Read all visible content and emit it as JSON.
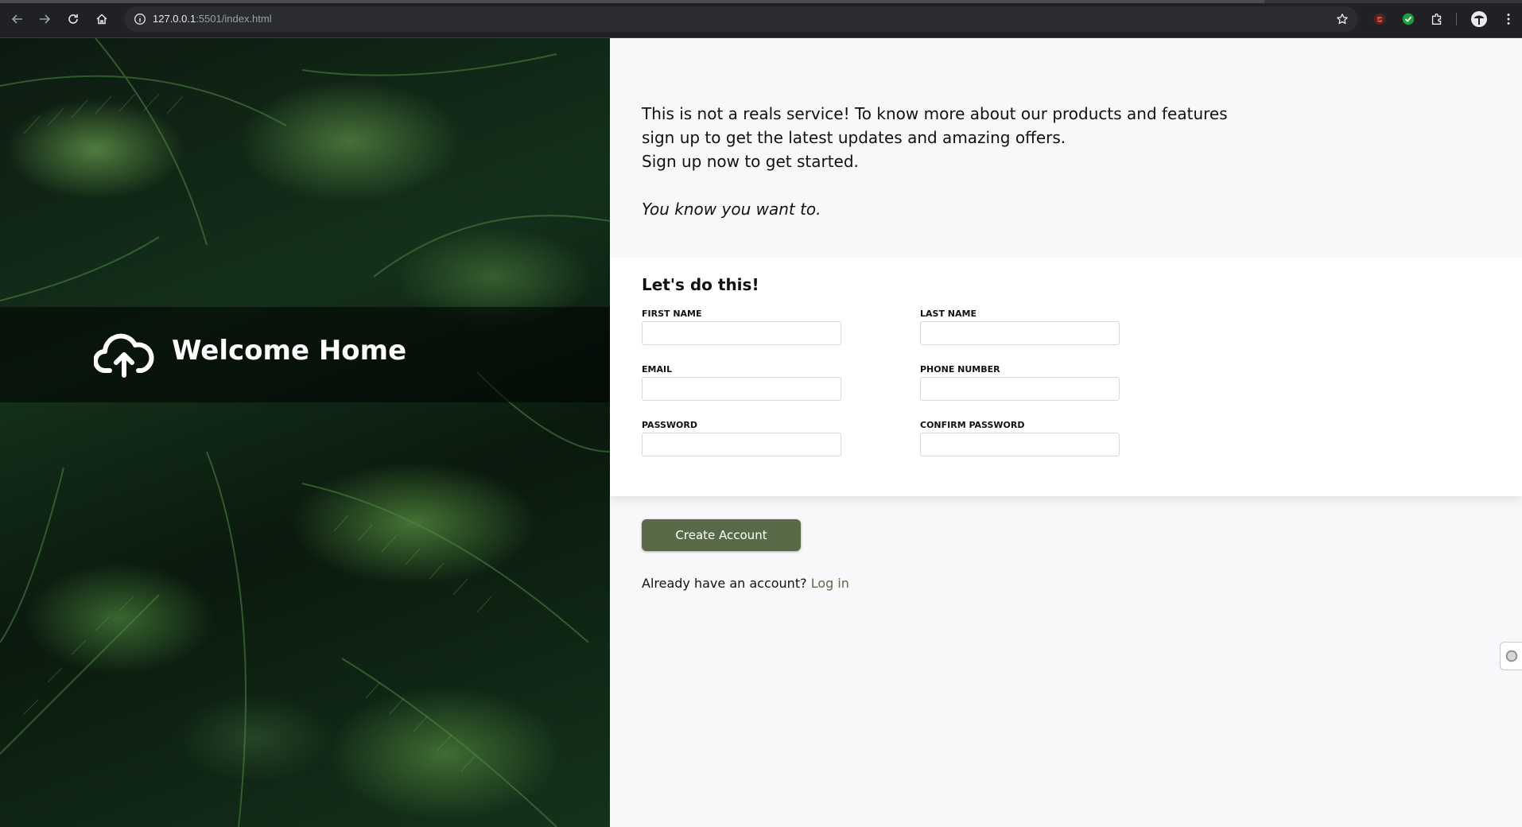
{
  "browser": {
    "url_host": "127.0.0.1",
    "url_rest": ":5501/index.html",
    "icons": [
      "back-arrow-icon",
      "forward-arrow-icon",
      "reload-icon",
      "home-icon",
      "site-info-icon",
      "bookmark-star-icon",
      "extension-shield-icon",
      "extension-check-icon",
      "extensions-puzzle-icon",
      "profile-avatar-icon",
      "more-menu-icon"
    ]
  },
  "hero": {
    "brand": "Welcome Home",
    "logo_icon": "cloud-upload-icon"
  },
  "intro": {
    "line1": "This is not a reals service! To know more about our products and features",
    "line2": "sign up to get the latest updates and amazing offers.",
    "line3": "Sign up now to get started.",
    "tagline": "You know you want to."
  },
  "form": {
    "heading": "Let's do this!",
    "fields": [
      {
        "label": "FIRST NAME",
        "value": ""
      },
      {
        "label": "LAST NAME",
        "value": ""
      },
      {
        "label": "EMAIL",
        "value": ""
      },
      {
        "label": "PHONE NUMBER",
        "value": ""
      },
      {
        "label": "PASSWORD",
        "value": ""
      },
      {
        "label": "CONFIRM PASSWORD",
        "value": ""
      }
    ],
    "submit_label": "Create Account"
  },
  "login": {
    "prompt": "Already have an account?",
    "link": "Log in"
  },
  "colors": {
    "accent": "#596a48",
    "page_bg": "#f8f8fa",
    "card_bg": "#ffffff"
  }
}
